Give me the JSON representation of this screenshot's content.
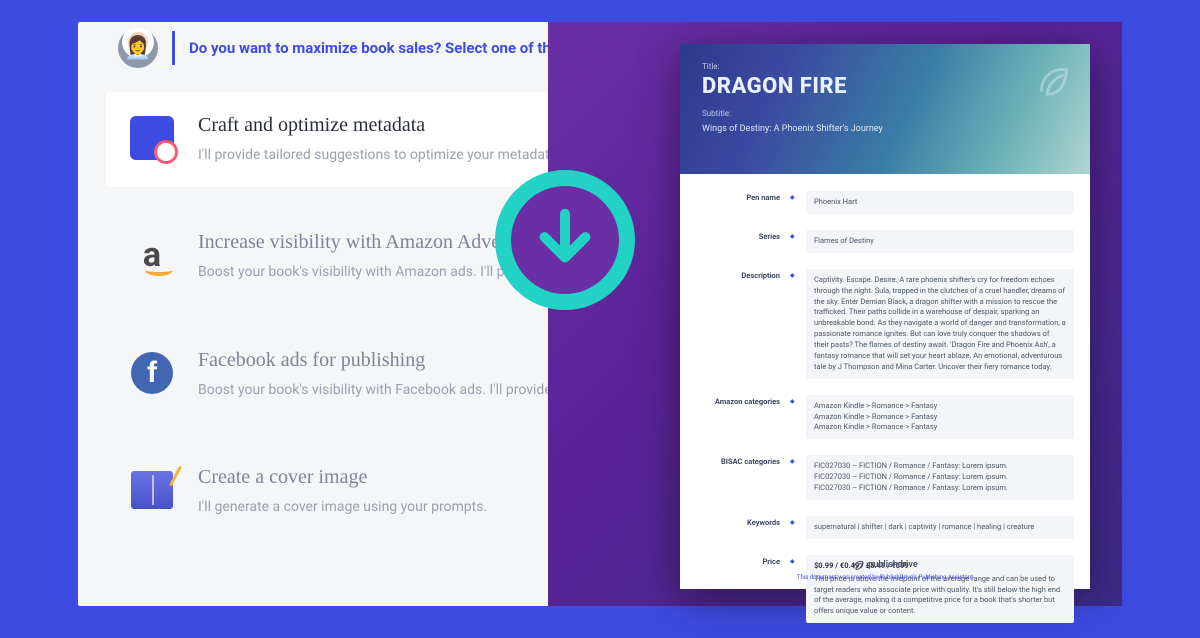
{
  "prompt": "Do you want to maximize book sales? Select one of the follo",
  "options": [
    {
      "key": "metadata",
      "title": "Craft and optimize metadata",
      "desc": "I'll provide tailored suggestions to optimize your metadat"
    },
    {
      "key": "amazon",
      "title": "Increase visibility with Amazon Adverstisi",
      "desc": "Boost your book's visibility with Amazon ads. I'll provide t"
    },
    {
      "key": "facebook",
      "title": "Facebook ads for publishing",
      "desc": "Boost your book's visibility with Facebook ads. I'll provide"
    },
    {
      "key": "cover",
      "title": "Create a cover image",
      "desc": "I'll generate a cover image using your prompts."
    }
  ],
  "doc": {
    "label_title": "Title:",
    "title": "DRAGON FIRE",
    "label_subtitle": "Subtitle:",
    "subtitle": "Wings of Destiny: A Phoenix Shifter's Journey",
    "rows": {
      "pen_name": {
        "k": "Pen name",
        "v": "Phoenix Hart"
      },
      "series": {
        "k": "Series",
        "v": "Flames of Destiny"
      },
      "description": {
        "k": "Description",
        "v": "Captivity. Escape. Desire. A rare phoenix shifter's cry for freedom echoes through the night. Sula, trapped in the clutches of a cruel handler, dreams of the sky. Enter Demian Black, a dragon shifter with a mission to rescue the trafficked. Their paths collide in a warehouse of despair, sparking an unbreakable bond. As they navigate a world of danger and transformation, a passionate romance ignites. But can love truly conquer the shadows of their pasts? The flames of destiny await. 'Dragon Fire and Phoenix Ash', a fantasy romance that will set your heart ablaze. An emotional, adventurous tale by J Thompson and Mina Carter. Uncover their fiery romance today."
      },
      "amazon_categories": {
        "k": "Amazon categories",
        "lines": [
          "Amazon Kindle  >  Romance  >  Fantasy",
          "Amazon Kindle  >  Romance  >  Fantasy",
          "Amazon Kindle  >  Romance  >  Fantasy"
        ]
      },
      "bisac_categories": {
        "k": "BISAC categories",
        "lines": [
          "FIC027030 – FICTION  /  Romance  /  Fantasy: Lorem ipsum.",
          "FIC027030 – FICTION  /  Romance  /  Fantasy: Lorem ipsum.",
          "FIC027030 – FICTION  /  Romance  /  Fantasy: Lorem ipsum."
        ]
      },
      "keywords": {
        "k": "Keywords",
        "v": "supernatural | shifter | dark | captivity | romance | healing | creature"
      },
      "price": {
        "k": "Price",
        "head": "$0.99 / €0.49 / £5.49 / ₹599",
        "v": "This price is above the midpoint of the average range and can be used to target readers who associate price with quality. It's still below the high end of the average, making it a competitive price for a book that's shorter but offers unique value or content."
      }
    },
    "footer_brand": "publishdrive",
    "footer_note": "This document was created by PublishDrive's Publishing Assistant"
  },
  "colors": {
    "bg": "#3e4be0",
    "teal": "#22d3c5",
    "purple": "#6a2fa5"
  }
}
